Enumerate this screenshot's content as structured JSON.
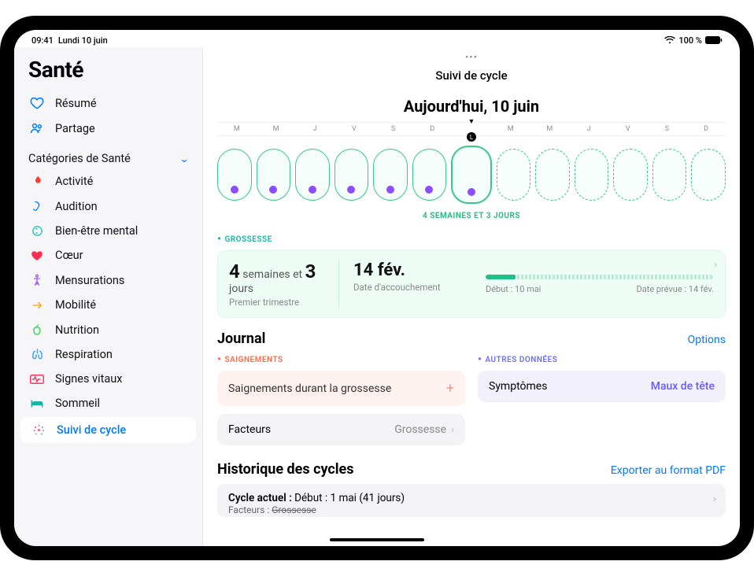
{
  "statusbar": {
    "time": "09:41",
    "date": "Lundi 10 juin",
    "battery_pct": "100 %"
  },
  "sidebar": {
    "title": "Santé",
    "resume": "Résumé",
    "partage": "Partage",
    "categories_header": "Catégories de Santé",
    "items": [
      {
        "key": "activite",
        "label": "Activité",
        "color": "#ff3b30",
        "icon": "flame"
      },
      {
        "key": "audition",
        "label": "Audition",
        "color": "#0a84ff",
        "icon": "ear"
      },
      {
        "key": "bien_etre",
        "label": "Bien-être mental",
        "color": "#2bc8b5",
        "icon": "brain"
      },
      {
        "key": "coeur",
        "label": "Cœur",
        "color": "#ff2d55",
        "icon": "heart"
      },
      {
        "key": "mensurations",
        "label": "Mensurations",
        "color": "#a259ff",
        "icon": "body"
      },
      {
        "key": "mobilite",
        "label": "Mobilité",
        "color": "#ff9f0a",
        "icon": "arrow"
      },
      {
        "key": "nutrition",
        "label": "Nutrition",
        "color": "#30d158",
        "icon": "apple"
      },
      {
        "key": "respiration",
        "label": "Respiration",
        "color": "#2aa3ff",
        "icon": "lungs"
      },
      {
        "key": "signes_vitaux",
        "label": "Signes vitaux",
        "color": "#ff375f",
        "icon": "ecg"
      },
      {
        "key": "sommeil",
        "label": "Sommeil",
        "color": "#1ab3a6",
        "icon": "bed"
      },
      {
        "key": "suivi_cycle",
        "label": "Suivi de cycle",
        "color": "#ff5a8f",
        "icon": "cycle",
        "selected": true
      }
    ]
  },
  "page": {
    "title": "Suivi de cycle",
    "today_label": "Aujourd'hui, 10 juin",
    "dow": [
      "M",
      "M",
      "J",
      "V",
      "S",
      "D",
      "L",
      "M",
      "M",
      "J",
      "V",
      "S",
      "D"
    ],
    "today_letter": "L",
    "duration_label": "4 SEMAINES ET 3 JOURS"
  },
  "pregnancy": {
    "tag": "GROSSESSE",
    "weeks_num": "4",
    "weeks_unit": "semaines et",
    "days_num": "3",
    "days_unit": "jours",
    "trimester": "Premier trimestre",
    "due_date_short": "14 fév.",
    "due_date_label": "Date d'accouchement",
    "start_label": "Début : 10 mai",
    "expected_label": "Date prévue : 14 fév."
  },
  "journal": {
    "heading": "Journal",
    "options": "Options",
    "bleeding_tag": "SAIGNEMENTS",
    "bleeding_row": "Saignements durant la grossesse",
    "factors_label": "Facteurs",
    "factors_value": "Grossesse",
    "other_tag": "AUTRES DONNÉES",
    "symptoms_label": "Symptômes",
    "symptoms_value": "Maux de tête"
  },
  "history": {
    "heading": "Historique des cycles",
    "export": "Exporter au format PDF",
    "current_label": "Cycle actuel :",
    "current_value": "Début : 1 mai (41 jours)",
    "sub_label": "Facteurs :",
    "sub_value": "Grossesse"
  }
}
